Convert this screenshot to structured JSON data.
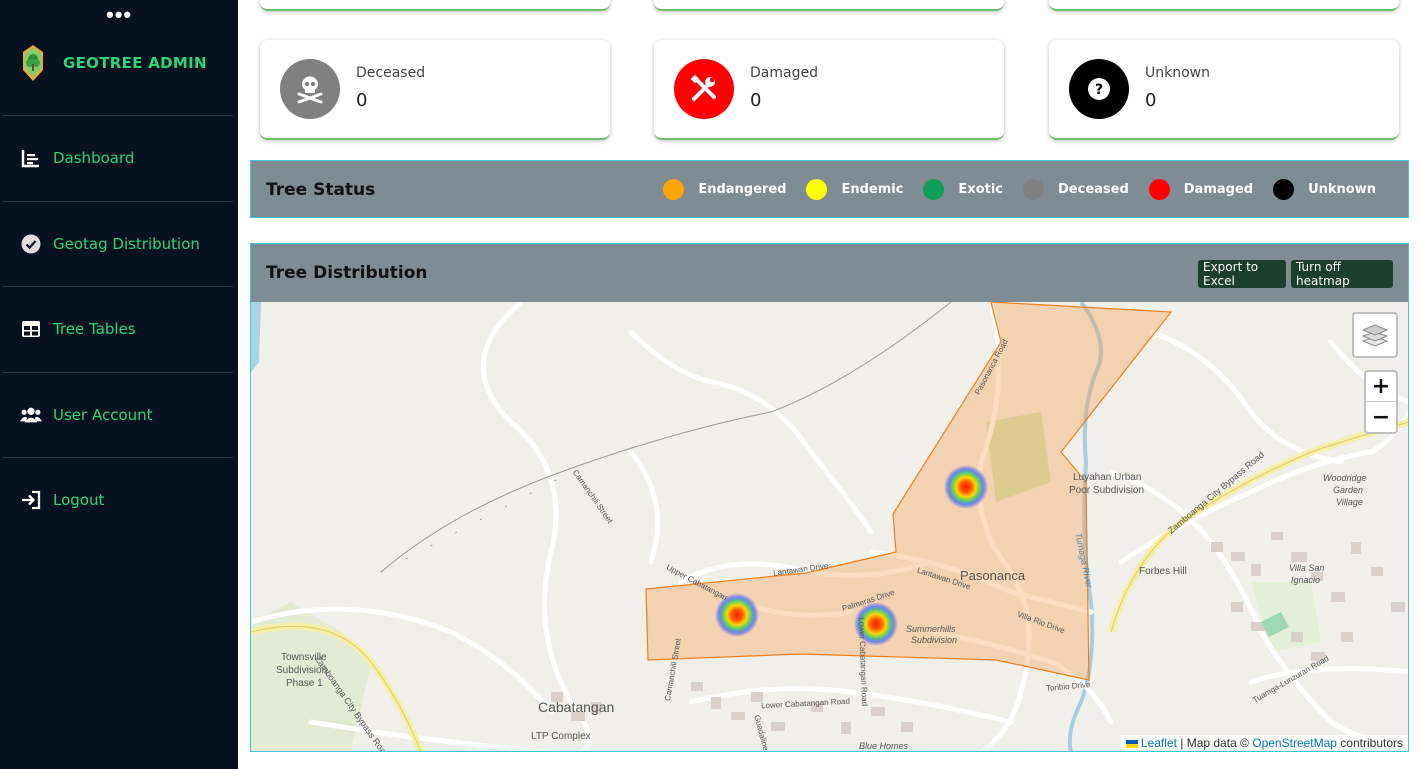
{
  "sidebar": {
    "menu_dots": "•••",
    "brand": "GEOTREE ADMIN",
    "items": [
      {
        "label": "Dashboard",
        "icon": "chart-bar-icon"
      },
      {
        "label": "Geotag Distribution",
        "icon": "check-circle-icon"
      },
      {
        "label": "Tree Tables",
        "icon": "table-icon"
      },
      {
        "label": "User Account",
        "icon": "users-icon"
      },
      {
        "label": "Logout",
        "icon": "logout-icon"
      }
    ]
  },
  "cards": [
    {
      "label": "Deceased",
      "value": "0",
      "color": "#808080",
      "icon": "skull-icon"
    },
    {
      "label": "Damaged",
      "value": "0",
      "color": "#ff0000",
      "icon": "tools-icon"
    },
    {
      "label": "Unknown",
      "value": "0",
      "color": "#000000",
      "icon": "question-icon"
    }
  ],
  "status_panel": {
    "title": "Tree Status",
    "legend": [
      {
        "label": "Endangered",
        "color": "#ffa500"
      },
      {
        "label": "Endemic",
        "color": "#ffff00"
      },
      {
        "label": "Exotic",
        "color": "#0f9d58"
      },
      {
        "label": "Deceased",
        "color": "#808080"
      },
      {
        "label": "Damaged",
        "color": "#ff0000"
      },
      {
        "label": "Unknown",
        "color": "#000000"
      }
    ]
  },
  "distribution_panel": {
    "title": "Tree Distribution",
    "export_button": "Export to Excel",
    "heatmap_button": "Turn off heatmap"
  },
  "map": {
    "zoom_in": "+",
    "zoom_out": "−",
    "attribution_leaflet": "Leaflet",
    "attribution_sep": " | Map data © ",
    "attribution_osm": "OpenStreetMap",
    "attribution_tail": " contributors",
    "labels": {
      "pasonanca": "Pasonanca",
      "cabatangan": "Cabatangan",
      "ltp": "LTP Complex",
      "luyahan": "Luyahan Urban",
      "luyahan2": "Poor Subdivision",
      "forbes": "Forbes Hill",
      "townsville": "Townsville",
      "townsville2": "Subdivision",
      "townsville3": "Phase 1",
      "woodridge": "Woodridge",
      "woodridge2": "Garden",
      "woodridge3": "Village",
      "villa_san": "Villa San",
      "ignacio": "Ignacio",
      "summerhills": "Summerhills",
      "summerhills2": "Subdivision",
      "blue_homes": "Blue Homes",
      "lantawan1": "Lantawan Drive",
      "lantawan2": "Lantawan Drive",
      "palmeras": "Palmeras Drive",
      "lower_cab": "Lower Cabatangan Road",
      "lower_cab_v": "Lower Cabatangan Road",
      "villa_rio": "Villa Rio Drive",
      "toribio": "Toribio Drive",
      "upper_cab": "Upper Cabatangan",
      "camanchili": "Camanchili Street",
      "camanchili2": "Camanchili Street",
      "pasonanca_rd": "Pasonanca Road",
      "bypass_left": "Zamboanga City Bypass Road",
      "bypass_right": "Zamboanga City Bypass Road",
      "tumaga": "Tumaga River",
      "tuamga_lunz": "Tuamga-Lunzuran Road",
      "guadaline": "Guadaline Dr"
    }
  }
}
